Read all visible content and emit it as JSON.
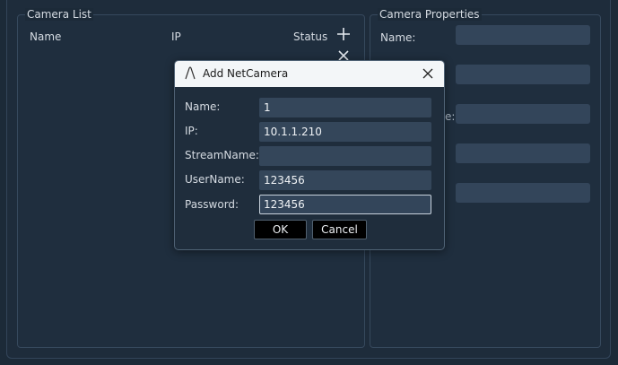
{
  "camera_list": {
    "title": "Camera List",
    "columns": [
      "Name",
      "IP",
      "Status"
    ],
    "add_icon": "plus-icon",
    "remove_icon": "close-icon"
  },
  "camera_properties": {
    "title": "Camera Properties",
    "name_label": "Name:",
    "partial_label": "e:"
  },
  "dialog": {
    "title": "Add NetCamera",
    "fields": {
      "name": {
        "label": "Name:",
        "value": "1"
      },
      "ip": {
        "label": "IP:",
        "value": "10.1.1.210"
      },
      "stream_name": {
        "label": "StreamName:",
        "value": ""
      },
      "user_name": {
        "label": "UserName:",
        "value": "123456"
      },
      "password": {
        "label": "Password:",
        "value": "123456"
      }
    },
    "ok_label": "OK",
    "cancel_label": "Cancel"
  },
  "colors": {
    "background": "#1c2a38",
    "field": "#33455a",
    "titlebar": "#f3f6f8"
  }
}
